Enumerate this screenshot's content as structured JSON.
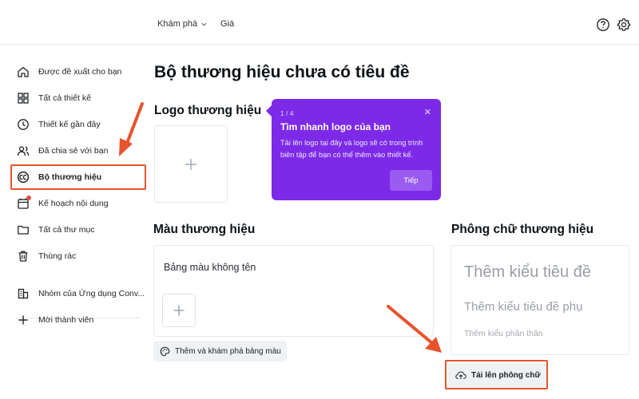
{
  "topbar": {
    "explore_label": "Khám phá",
    "price_label": "Giá"
  },
  "sidebar": {
    "items": [
      {
        "label": "Được đề xuất cho bạn",
        "icon": "home-icon"
      },
      {
        "label": "Tất cả thiết kế",
        "icon": "grid-icon"
      },
      {
        "label": "Thiết kế gần đây",
        "icon": "clock-icon"
      },
      {
        "label": "Đã chia sẻ với bạn",
        "icon": "shared-users-icon"
      },
      {
        "label": "Bộ thương hiệu",
        "icon": "brand-kit-icon",
        "active": true
      },
      {
        "label": "Kế hoạch nội dung",
        "icon": "calendar-icon"
      },
      {
        "label": "Tất cả thư mục",
        "icon": "folder-icon"
      },
      {
        "label": "Thùng rác",
        "icon": "trash-icon"
      },
      {
        "label": "Nhóm của Ứng dụng Conv...",
        "icon": "team-building-icon"
      },
      {
        "label": "Mời thành viên",
        "icon": "plus-icon"
      }
    ]
  },
  "main": {
    "page_title": "Bộ thương hiệu chưa có tiêu đề",
    "logo_section_title": "Logo thương hiệu",
    "color_section_title": "Màu thương hiệu",
    "palette_name": "Bảng màu không tên",
    "palette_button": "Thêm và khám phá bảng màu",
    "font_section_title": "Phông chữ thương hiệu",
    "font_heading": "Thêm kiểu tiêu đề",
    "font_subheading": "Thêm kiểu tiêu đề phụ",
    "font_body": "Thêm kiểu phần thân",
    "upload_button": "Tải lên phông chữ"
  },
  "tooltip": {
    "step": "1 / 4",
    "title": "Tìm nhanh logo của bạn",
    "body": "Tải lên logo tại đây và logo sẽ có trong trình biên tập để bạn có thể thêm vào thiết kế.",
    "next_label": "Tiếp"
  },
  "colors": {
    "accent_purple": "#7d2ae8",
    "highlight_red": "#e8532d"
  }
}
